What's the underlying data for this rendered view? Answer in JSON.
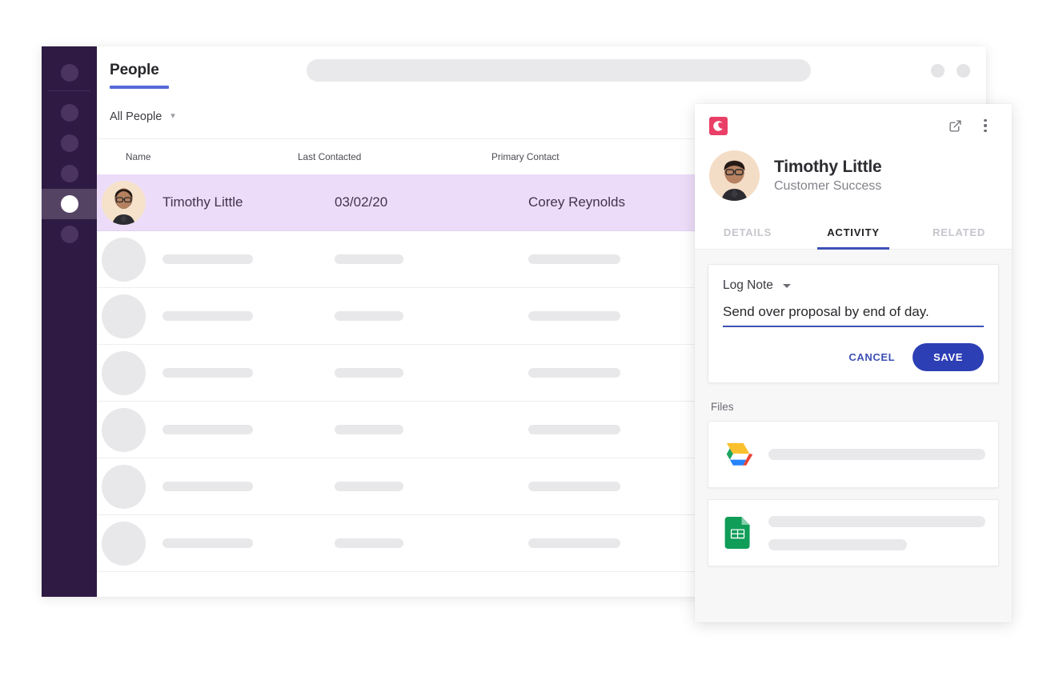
{
  "app": {
    "sidebar": {
      "items": [
        {
          "name": "nav-dot-1",
          "active": false
        },
        {
          "name": "nav-dot-2",
          "active": false
        },
        {
          "name": "nav-dot-3",
          "active": false
        },
        {
          "name": "nav-dot-4",
          "active": false
        },
        {
          "name": "nav-dot-5",
          "active": true
        },
        {
          "name": "nav-dot-6",
          "active": false
        }
      ]
    },
    "topbar": {
      "page_title": "People",
      "search_value": "",
      "search_placeholder": "",
      "accent_underline_color": "#5569d8"
    },
    "filterbar": {
      "view_label": "All People",
      "caret": "▾"
    },
    "table": {
      "columns": [
        "Name",
        "Last Contacted",
        "Primary Contact"
      ],
      "rows": [
        {
          "selected": true,
          "name": "Timothy Little",
          "last_contacted": "03/02/20",
          "primary_contact": "Corey Reynolds"
        },
        {
          "selected": false,
          "name": "",
          "last_contacted": "",
          "primary_contact": ""
        },
        {
          "selected": false,
          "name": "",
          "last_contacted": "",
          "primary_contact": ""
        },
        {
          "selected": false,
          "name": "",
          "last_contacted": "",
          "primary_contact": ""
        },
        {
          "selected": false,
          "name": "",
          "last_contacted": "",
          "primary_contact": ""
        },
        {
          "selected": false,
          "name": "",
          "last_contacted": "",
          "primary_contact": ""
        },
        {
          "selected": false,
          "name": "",
          "last_contacted": "",
          "primary_contact": ""
        }
      ]
    }
  },
  "detail_panel": {
    "logo_icon": "copper-crescent-icon",
    "logo_color": "#ea3f66",
    "open_in_new_label": "open-in-new-icon",
    "more_menu_label": "more-vertical-icon",
    "person": {
      "name": "Timothy Little",
      "role": "Customer Success"
    },
    "tabs": [
      {
        "label": "DETAILS",
        "active": false
      },
      {
        "label": "ACTIVITY",
        "active": true
      },
      {
        "label": "RELATED",
        "active": false
      }
    ],
    "note": {
      "type_label": "Log Note",
      "text": "Send over proposal by end of day.",
      "placeholder": "",
      "cancel_label": "CANCEL",
      "save_label": "SAVE",
      "accent_color": "#3f51b5",
      "save_bg": "#2d3fb5"
    },
    "files": {
      "title": "Files",
      "items": [
        {
          "icon": "google-drive-icon",
          "name": "",
          "subtext": null
        },
        {
          "icon": "google-sheets-icon",
          "name": "",
          "subtext": ""
        }
      ]
    }
  }
}
